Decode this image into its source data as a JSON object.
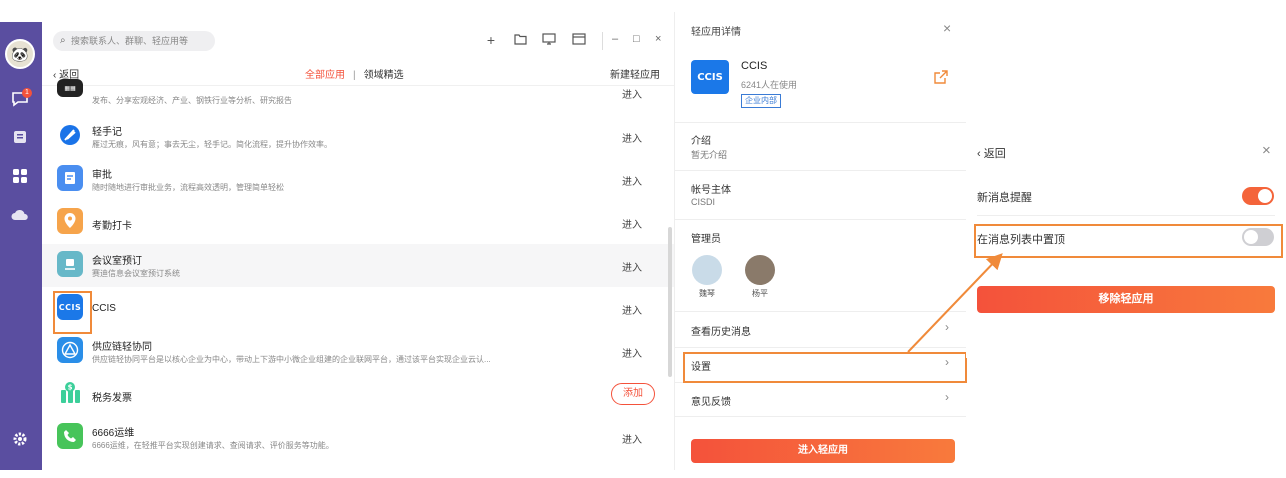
{
  "sidebar": {
    "unread_badge": "1",
    "items": [
      {
        "icon": "avatar"
      },
      {
        "icon": "chat-icon"
      },
      {
        "icon": "contacts-icon"
      },
      {
        "icon": "apps-icon"
      },
      {
        "icon": "cloud-icon"
      },
      {
        "icon": "settings-gear-icon"
      }
    ]
  },
  "topbar": {
    "search_placeholder": "搜索联系人、群聊、轻应用等",
    "window_controls": [
      "–",
      "□",
      "×"
    ]
  },
  "subbar": {
    "back_label": "返回",
    "tab_all": "全部应用",
    "tab_divider": "|",
    "tab_domain": "领域精选",
    "new_app": "新建轻应用"
  },
  "apps": [
    {
      "title": "",
      "desc": "发布、分享宏观经济、产业、钢铁行业等分析、研究报告",
      "action": "进入",
      "color": "#222222"
    },
    {
      "title": "轻手记",
      "desc": "雁过无痕，风有意；事去无尘，轻手记。简化流程，提升协作效率。",
      "action": "进入",
      "color": "#1a73e8"
    },
    {
      "title": "审批",
      "desc": "随时随地进行审批业务，流程高效透明，管理简单轻松",
      "action": "进入",
      "color": "#4a8ef0"
    },
    {
      "title": "考勤打卡",
      "desc": "",
      "action": "进入",
      "color": "#f6a44b"
    },
    {
      "title": "会议室预订",
      "desc": "赛迪信息会议室预订系统",
      "action": "进入",
      "color": "#67b8c8"
    },
    {
      "title": "CCIS",
      "desc": "",
      "action": "进入",
      "color": "#1b78e8"
    },
    {
      "title": "供应链轻协同",
      "desc": "供应链轻协同平台是以核心企业为中心，带动上下游中小微企业组建的企业联网平台，通过该平台实现企业云认...",
      "action": "进入",
      "color": "#2a8ee8"
    },
    {
      "title": "税务发票",
      "desc": "",
      "action": "添加",
      "color": "#3ccf9a"
    },
    {
      "title": "6666运维",
      "desc": "6666运维，在轻推平台实现创建请求、查阅请求、评价服务等功能。",
      "action": "进入",
      "color": "#47c45a"
    }
  ],
  "detail": {
    "header": "轻应用详情",
    "app_name": "CCIS",
    "logo_text": "CCIS",
    "users": "6241人在使用",
    "tag": "企业内部",
    "intro_label": "介绍",
    "intro_value": "暂无介绍",
    "owner_label": "帐号主体",
    "owner_value": "CISDI",
    "admins_label": "管理员",
    "admins": [
      {
        "name": "魏琴",
        "color": "#c9dbe8"
      },
      {
        "name": "杨平",
        "color": "#8a7a6a"
      }
    ],
    "history_label": "查看历史消息",
    "settings_label": "设置",
    "feedback_label": "意见反馈",
    "enter_button": "进入轻应用"
  },
  "settings": {
    "back_label": "返回",
    "notify_label": "新消息提醒",
    "notify_on": true,
    "pin_label": "在消息列表中置顶",
    "pin_on": false,
    "remove_button": "移除轻应用"
  },
  "colors": {
    "accent": "#f4523b",
    "sidebar": "#5a4ea0",
    "highlight": "#f08a3a",
    "brand_blue": "#1b78e8"
  }
}
